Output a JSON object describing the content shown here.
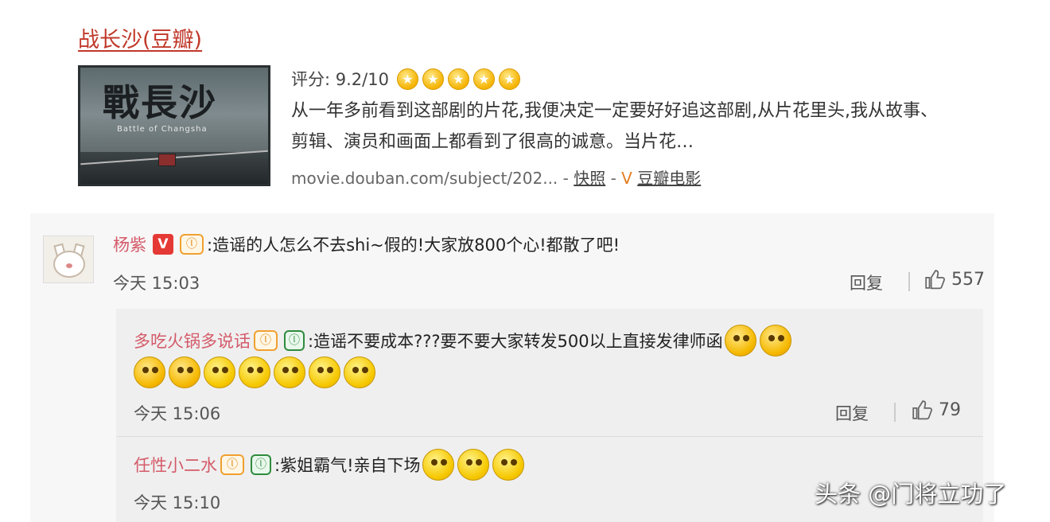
{
  "result": {
    "title": "战长沙(豆瓣)",
    "poster": {
      "title": "戰長沙",
      "subtitle": "Battle of Changsha"
    },
    "rating_label": "评分: 9.2/10",
    "stars": 5,
    "snippet": "从一年多前看到这部剧的片花,我便决定一定要好好追这部剧,从片花里头,我从故事、剪辑、演员和画面上都看到了很高的诚意。当片花…",
    "url": "movie.douban.com/subject/202...",
    "dash1": "-",
    "snapshot": "快照",
    "dash2": "-",
    "v": "V",
    "site": "豆瓣电影"
  },
  "comment": {
    "user": "杨紫",
    "v_badge": "V",
    "fan_badge": "ⓛ",
    "text": ":造谣的人怎么不去shi~假的!大家放800个心!都散了吧!",
    "time": "今天 15:03",
    "reply": "回复",
    "likes": "557"
  },
  "replies": [
    {
      "user": "多吃火锅多说话",
      "fan_badge": "ⓛ",
      "leaf_badge": "ⓛ",
      "text": ":造谣不要成本???要不要大家转发500以上直接发律师函",
      "time": "今天 15:06",
      "reply": "回复",
      "likes": "79"
    },
    {
      "user": "任性小二水",
      "fan_badge": "ⓛ",
      "leaf_badge": "ⓛ",
      "text": ":紫姐霸气!亲自下场",
      "time": "今天 15:10"
    }
  ],
  "watermark": "头条 @门将立功了"
}
